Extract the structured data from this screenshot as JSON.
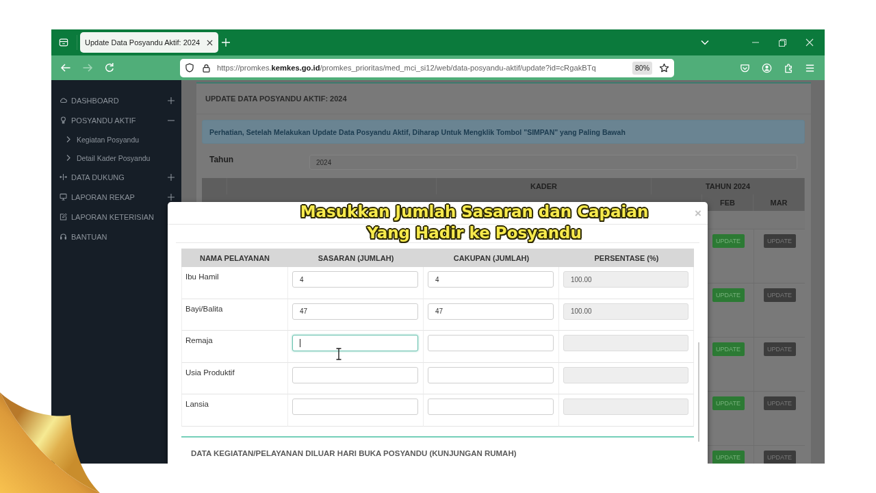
{
  "browser": {
    "tabs": [
      {
        "title": "Update Data Posyandu Aktif: 2024",
        "selected": true
      }
    ],
    "back_button": {
      "disabled": false
    },
    "forward_button": {
      "disabled": true
    },
    "url": "https://promkes.**kemkes.go.id**/promkes_prioritas/med_mci_si12/web/data-posyandu-aktif/update?id=cRgakBTq",
    "zoom": "80%"
  },
  "sidebar": {
    "items": [
      {
        "label": "DASHBOARD",
        "kind": "group",
        "expanded": false
      },
      {
        "label": "POSYANDU AKTIF",
        "kind": "group",
        "expanded": true,
        "children": [
          {
            "label": "Kegiatan Posyandu"
          },
          {
            "label": "Detail Kader Posyandu"
          }
        ]
      },
      {
        "label": "DATA DUKUNG",
        "kind": "group",
        "expanded": false
      },
      {
        "label": "LAPORAN REKAP",
        "kind": "group",
        "expanded": false
      },
      {
        "label": "LAPORAN KETERISIAN",
        "kind": "link"
      },
      {
        "label": "BANTUAN",
        "kind": "link"
      }
    ]
  },
  "page": {
    "title": "UPDATE DATA POSYANDU AKTIF: 2024",
    "alert": "Perhatian, Setelah Melakukan Update Data Posyandu Aktif, Diharap Untuk Mengklik Tombol \"SIMPAN\" yang Paling Bawah",
    "year_label": "Tahun",
    "year_value": "2024",
    "table": {
      "group_headers": [
        "KADER",
        "TAHUN 2024"
      ],
      "month_columns": [
        "FEB",
        "MAR"
      ],
      "rows": [
        {
          "cells": [
            {
              "label": "UPDATE",
              "disabled": false
            },
            {
              "label": "UPDATE",
              "disabled": true
            }
          ]
        },
        {
          "cells": [
            {
              "label": "UPDATE",
              "disabled": false
            },
            {
              "label": "UPDATE",
              "disabled": true
            }
          ]
        },
        {
          "cells": [
            {
              "label": "UPDATE",
              "disabled": false
            },
            {
              "label": "UPDATE",
              "disabled": true
            }
          ]
        },
        {
          "cells": [
            {
              "label": "UPDATE",
              "disabled": false
            },
            {
              "label": "UPDATE",
              "disabled": true
            }
          ]
        },
        {
          "cells": [
            {
              "label": "UPDATE",
              "disabled": false
            },
            {
              "label": "UPDATE",
              "disabled": true
            }
          ]
        }
      ]
    }
  },
  "modal": {
    "close_label": "×",
    "columns": [
      "NAMA PELAYANAN",
      "SASARAN (JUMLAH)",
      "CAKUPAN (JUMLAH)",
      "PERSENTASE (%)"
    ],
    "rows": [
      {
        "name": "Ibu Hamil",
        "sasaran": {
          "value": "4",
          "focused": false
        },
        "cakupan": {
          "value": "4",
          "focused": false
        },
        "persentase": "100.00"
      },
      {
        "name": "Bayi/Balita",
        "sasaran": {
          "value": "47",
          "focused": false
        },
        "cakupan": {
          "value": "47",
          "focused": false
        },
        "persentase": "100.00"
      },
      {
        "name": "Remaja",
        "sasaran": {
          "focused": true
        },
        "cakupan": {
          "focused": false
        }
      },
      {
        "name": "Usia Produktif",
        "sasaran": {
          "focused": false
        },
        "cakupan": {
          "focused": false
        }
      },
      {
        "name": "Lansia",
        "sasaran": {
          "focused": false
        },
        "cakupan": {
          "focused": false
        }
      }
    ],
    "section_title": "DATA KEGIATAN/PELAYANAN DILUAR HARI BUKA POSYANDU (KUNJUNGAN RUMAH)"
  },
  "caption": {
    "lines": [
      "Masukkan Jumlah Sasaran dan Capaian",
      "Yang Hadir ke Posyandu"
    ]
  }
}
